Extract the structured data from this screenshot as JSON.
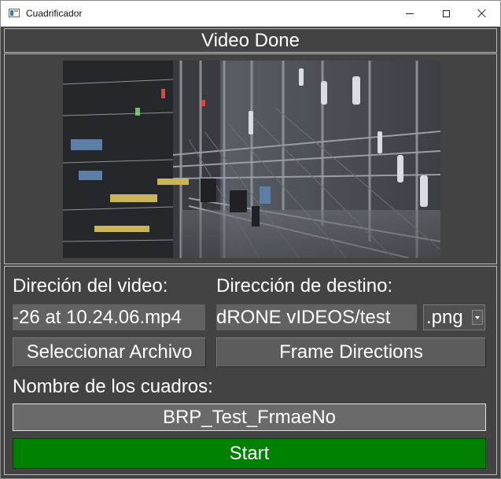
{
  "window": {
    "title": "Cuadrificador"
  },
  "status": {
    "text": "Video Done"
  },
  "source": {
    "label": "Direción del video:",
    "path_value": "-26 at 10.24.06.mp4",
    "select_button": "Seleccionar Archivo"
  },
  "destination": {
    "label": "Dirección de destino:",
    "path_value": "dRONE vIDEOS/test",
    "format_selected": ".png",
    "frame_button": "Frame Directions"
  },
  "frames": {
    "label": "Nombre de los cuadros:",
    "name_value": "BRP_Test_FrmaeNo"
  },
  "actions": {
    "start_label": "Start"
  },
  "colors": {
    "window_bg": "#424242",
    "field_bg": "#626262",
    "start_button": "#008000",
    "text": "#ffffff"
  }
}
